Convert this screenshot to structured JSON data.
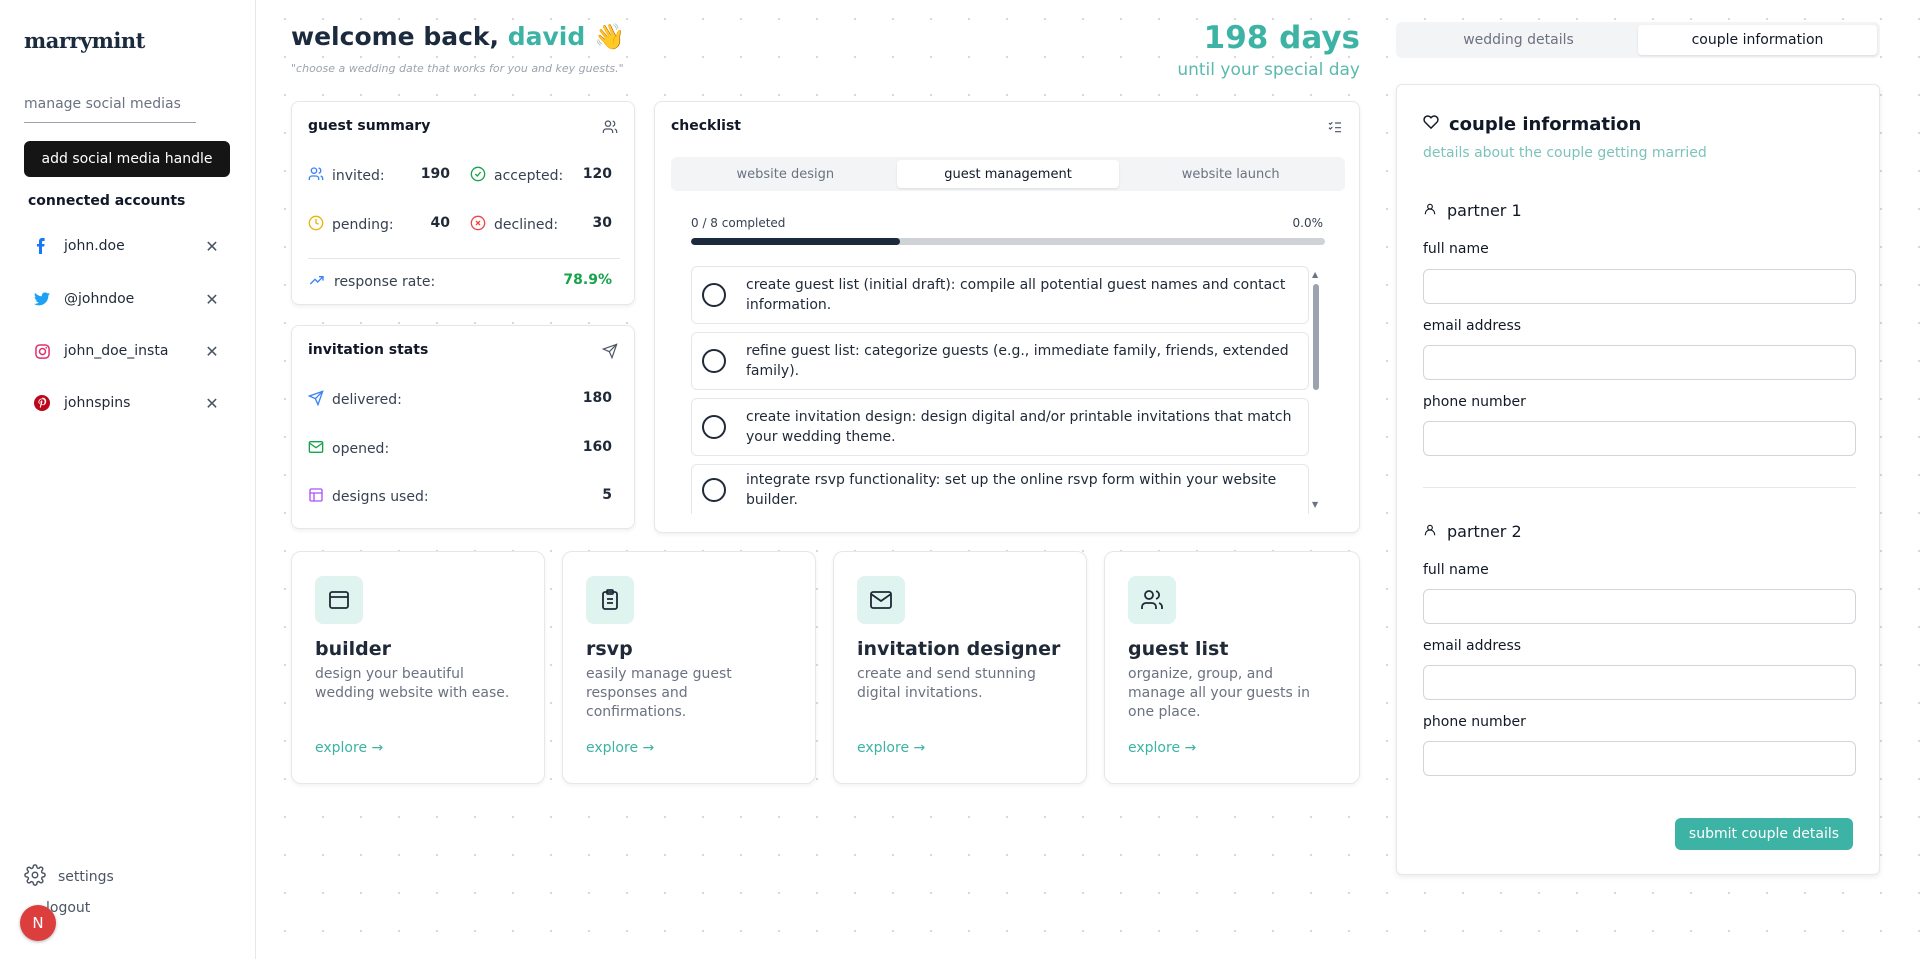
{
  "brand": {
    "logo": "marrymint"
  },
  "sidebar": {
    "manage_label": "manage social medias",
    "add_button": "add social media handle",
    "connected_heading": "connected accounts",
    "accounts": [
      {
        "platform": "facebook",
        "handle": "john.doe",
        "color": "#1877f2"
      },
      {
        "platform": "twitter",
        "handle": "@johndoe",
        "color": "#1da1f2"
      },
      {
        "platform": "instagram",
        "handle": "john_doe_insta",
        "color": "#e1306c"
      },
      {
        "platform": "pinterest",
        "handle": "johnspins",
        "color": "#bd081c"
      }
    ],
    "settings_label": "settings",
    "logout_label": "logout",
    "avatar_initial": "N"
  },
  "header": {
    "welcome_prefix": "welcome back, ",
    "user_name": "david",
    "wave": "👋",
    "subtitle": "\"choose a wedding date that works for you and key guests.\"",
    "countdown": "198 days",
    "countdown_sub": "until your special day"
  },
  "guest_summary": {
    "title": "guest summary",
    "invited_label": "invited:",
    "invited": "190",
    "accepted_label": "accepted:",
    "accepted": "120",
    "pending_label": "pending:",
    "pending": "40",
    "declined_label": "declined:",
    "declined": "30",
    "response_label": "response rate:",
    "response_rate": "78.9%"
  },
  "invitation_stats": {
    "title": "invitation stats",
    "delivered_label": "delivered:",
    "delivered": "180",
    "opened_label": "opened:",
    "opened": "160",
    "designs_label": "designs used:",
    "designs": "5"
  },
  "checklist": {
    "title": "checklist",
    "tabs": [
      "website design",
      "guest management",
      "website launch"
    ],
    "active_tab": "guest management",
    "progress_label": "0 / 8 completed",
    "progress_percent": "0.0%",
    "progress_bar_fraction": 0.33,
    "tasks": [
      "create guest list (initial draft): compile all potential guest names and contact information.",
      "refine guest list: categorize guests (e.g., immediate family, friends, extended family).",
      "create invitation design: design digital and/or printable invitations that match your wedding theme.",
      "integrate rsvp functionality: set up the online rsvp form within your website builder."
    ]
  },
  "features": [
    {
      "icon": "browser-icon",
      "title": "builder",
      "desc": "design your beautiful wedding website with ease.",
      "explore": "explore →"
    },
    {
      "icon": "clipboard-icon",
      "title": "rsvp",
      "desc": "easily manage guest responses and confirmations.",
      "explore": "explore →"
    },
    {
      "icon": "mail-icon",
      "title": "invitation designer",
      "desc": "create and send stunning digital invitations.",
      "explore": "explore →"
    },
    {
      "icon": "users-icon",
      "title": "guest list",
      "desc": "organize, group, and manage all your guests in one place.",
      "explore": "explore →"
    }
  ],
  "right_panel": {
    "tabs": [
      "wedding details",
      "couple information"
    ],
    "active_tab": "couple information",
    "title": "couple information",
    "description": "details about the couple getting married",
    "partner1": {
      "heading": "partner 1",
      "full_name_label": "full name",
      "full_name": "",
      "email_label": "email address",
      "email": "",
      "phone_label": "phone number",
      "phone": ""
    },
    "partner2": {
      "heading": "partner 2",
      "full_name_label": "full name",
      "full_name": "",
      "email_label": "email address",
      "email": "",
      "phone_label": "phone number",
      "phone": ""
    },
    "submit_button": "submit couple details"
  },
  "colors": {
    "accent": "#3cb3a5",
    "dark": "#1b2a3c",
    "success": "#16a34a"
  }
}
